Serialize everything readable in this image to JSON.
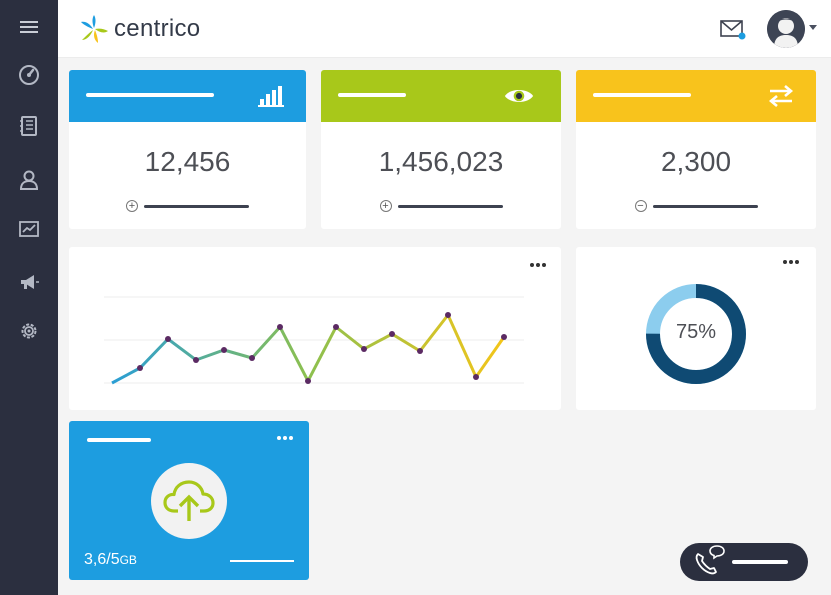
{
  "app": {
    "logo_text": "centrico"
  },
  "colors": {
    "sidebar": "#2b2f3f",
    "blue": "#1d9de0",
    "green": "#a8c81a",
    "yellow": "#f8c31c",
    "navy": "#0f4a73",
    "light_blue": "#8ccdee"
  },
  "sidebar": {
    "items": [
      {
        "icon": "hamburger-menu-icon"
      },
      {
        "icon": "dashboard-gauge-icon"
      },
      {
        "icon": "notebook-icon"
      },
      {
        "icon": "contacts-person-icon"
      },
      {
        "icon": "analytics-chart-icon"
      },
      {
        "icon": "megaphone-icon"
      },
      {
        "icon": "settings-gear-icon"
      }
    ]
  },
  "header": {
    "mail_icon": "mail-icon",
    "avatar_icon": "user-avatar-icon"
  },
  "stats": [
    {
      "value": "12,456",
      "icon": "bar-chart-icon",
      "sign": "+",
      "color": "#1d9de0"
    },
    {
      "value": "1,456,023",
      "icon": "eye-icon",
      "sign": "+",
      "color": "#a8c81a"
    },
    {
      "value": "2,300",
      "icon": "swap-arrows-icon",
      "sign": "−",
      "color": "#f8c31c"
    }
  ],
  "chart_data": {
    "type": "line",
    "values": [
      4,
      19,
      48,
      27,
      37,
      29,
      60,
      6,
      60,
      38,
      53,
      36,
      72,
      10,
      50
    ],
    "ylim": [
      0,
      100
    ],
    "grid": true,
    "gradient": [
      "#2a9ed5",
      "#8cc04f",
      "#f3c519"
    ]
  },
  "donut": {
    "label": "75%",
    "value": 0.75
  },
  "upload": {
    "size": "3,6/5",
    "unit": "GB",
    "icon": "cloud-upload-icon"
  },
  "call": {
    "icon": "phone-chat-icon"
  }
}
